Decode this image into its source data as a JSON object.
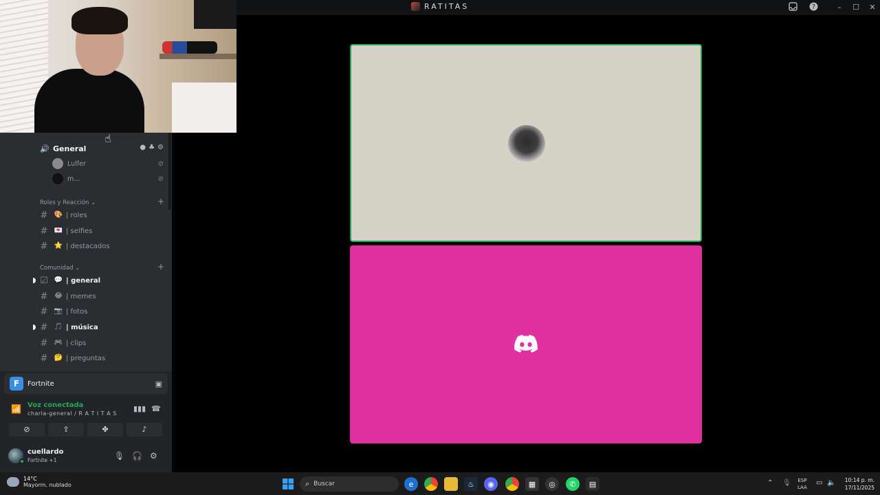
{
  "titlebar": {
    "server_title": "RATITAS",
    "icons": [
      "inbox-icon",
      "help-icon"
    ],
    "window_controls": {
      "minimize": "–",
      "maximize": "☐",
      "close": "✕"
    }
  },
  "sidebar": {
    "voice_channel": {
      "name": "General",
      "icon": "speaker-icon"
    },
    "voice_members": [
      {
        "name": "Lulfer",
        "muted": true
      },
      {
        "name": "m...",
        "muted": true
      }
    ],
    "categories": [
      {
        "label": "Roles y Reacción",
        "channels": [
          {
            "emoji": "🎨",
            "name": "| roles",
            "unread": false
          },
          {
            "emoji": "💌",
            "name": "| selfies",
            "unread": false
          },
          {
            "emoji": "⭐",
            "name": "| destacados",
            "unread": false
          }
        ]
      },
      {
        "label": "Comunidad",
        "channels": [
          {
            "emoji": "💬",
            "name": "| general",
            "unread": true
          },
          {
            "emoji": "😂",
            "name": "| memes",
            "unread": false
          },
          {
            "emoji": "📷",
            "name": "| fotos",
            "unread": false
          },
          {
            "emoji": "🎵",
            "name": "| música",
            "unread": true
          },
          {
            "emoji": "🎮",
            "name": "| clips",
            "unread": false
          },
          {
            "emoji": "🤔",
            "name": "| preguntas",
            "unread": false
          }
        ]
      }
    ]
  },
  "panel": {
    "game": {
      "name": "Fortnite",
      "icon_letter": "F"
    },
    "voice": {
      "status": "Voz conectada",
      "location": "charla-general / R A T I T A S"
    },
    "user": {
      "name": "cuellardo",
      "status": "Fortnite +1"
    }
  },
  "taskbar": {
    "weather": {
      "temp": "14°C",
      "desc": "Mayorm. nublado"
    },
    "search_placeholder": "Buscar",
    "lang_1": "ESP",
    "lang_2": "LAA",
    "time": "10:14 p. m.",
    "date": "17/11/2025"
  },
  "colors": {
    "speaking_border": "#23a55a",
    "tile_pink": "#e0309f",
    "tile_beige": "#d5d3c6",
    "voice_green": "#23a55a"
  }
}
